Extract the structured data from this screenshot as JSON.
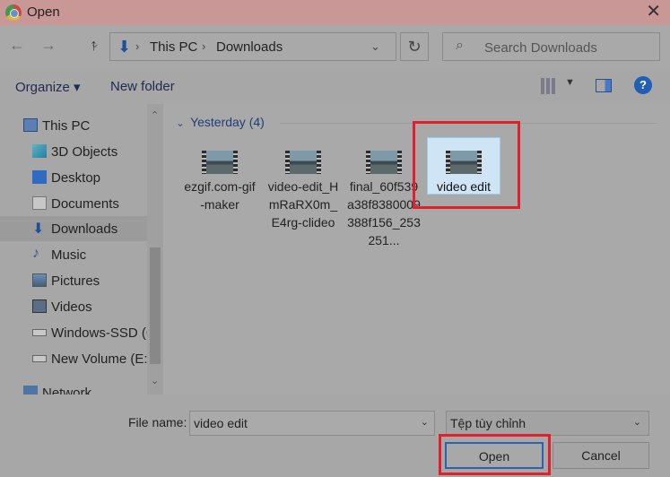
{
  "window": {
    "title": "Open",
    "app_icon": "chrome-icon",
    "close_glyph": "✕"
  },
  "nav": {
    "back": "←",
    "forward": "→",
    "up": "↑",
    "breadcrumbs": [
      "This PC",
      "Downloads"
    ],
    "refresh": "↻",
    "search_placeholder": "Search Downloads"
  },
  "toolbar": {
    "organize_label": "Organize ▾",
    "new_folder_label": "New folder",
    "help": "?"
  },
  "sidebar": {
    "items": [
      {
        "label": "This PC",
        "icon": "computer-icon"
      },
      {
        "label": "3D Objects",
        "icon": "cube-icon"
      },
      {
        "label": "Desktop",
        "icon": "desktop-icon"
      },
      {
        "label": "Documents",
        "icon": "documents-icon"
      },
      {
        "label": "Downloads",
        "icon": "downloads-icon",
        "selected": true
      },
      {
        "label": "Music",
        "icon": "music-icon"
      },
      {
        "label": "Pictures",
        "icon": "pictures-icon"
      },
      {
        "label": "Videos",
        "icon": "videos-icon"
      },
      {
        "label": "Windows-SSD (C",
        "icon": "drive-icon"
      },
      {
        "label": "New Volume (E:)",
        "icon": "drive-icon"
      },
      {
        "label": "Network",
        "icon": "network-icon"
      }
    ]
  },
  "files": {
    "group_label": "Yesterday (4)",
    "items": [
      {
        "name": "ezgif.com-gif-maker"
      },
      {
        "name": "video-edit_HmRaRX0m_E4rg-clideo"
      },
      {
        "name": "final_60f539a38f8380009388f156_253251..."
      },
      {
        "name": "video edit",
        "selected": true
      }
    ]
  },
  "footer": {
    "filename_label": "File name:",
    "filename_value": "video edit",
    "filter_value": "Tệp tùy chỉnh",
    "open_label": "Open",
    "cancel_label": "Cancel"
  },
  "colors": {
    "highlight": "#e0202a",
    "accent": "#1f5fb5"
  }
}
